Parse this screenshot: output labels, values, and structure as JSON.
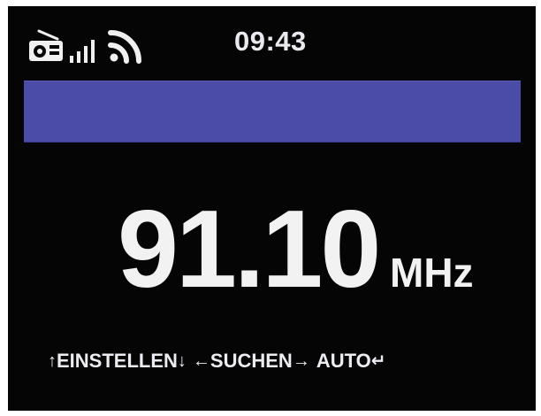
{
  "status_bar": {
    "time": "09:43",
    "icons": [
      "radio-icon",
      "signal-strength-icon",
      "wifi-icon"
    ]
  },
  "station_bar": {
    "name": "",
    "color": "#4a4ca8"
  },
  "frequency": {
    "value": "91.10",
    "unit": "MHz"
  },
  "controls": {
    "tune": {
      "label": "EINSTELLEN",
      "left_icon": "↑",
      "right_icon": "↓"
    },
    "search": {
      "label": "SUCHEN",
      "left_icon": "←",
      "right_icon": "→"
    },
    "auto": {
      "label": "AUTO",
      "right_icon": "↵"
    }
  },
  "colors": {
    "screen_background": "#050505",
    "text": "#f2f2f2",
    "station_bar": "#4a4ca8"
  }
}
